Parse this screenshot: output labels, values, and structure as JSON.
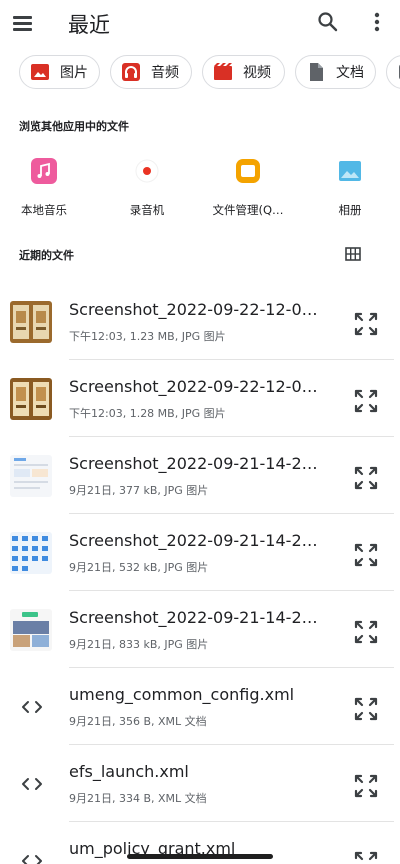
{
  "header": {
    "title": "最近"
  },
  "chips": [
    {
      "label": "图片",
      "icon": "image-icon",
      "color": "#d93025"
    },
    {
      "label": "音频",
      "icon": "headphones-icon",
      "color": "#d93025"
    },
    {
      "label": "视频",
      "icon": "video-icon",
      "color": "#d93025"
    },
    {
      "label": "文档",
      "icon": "document-icon",
      "color": "#5f6368"
    }
  ],
  "other_apps": {
    "title": "浏览其他应用中的文件",
    "items": [
      {
        "label": "本地音乐",
        "icon": "music-icon",
        "color": "#ee5b9d"
      },
      {
        "label": "录音机",
        "icon": "record-icon",
        "color": "#ea3323"
      },
      {
        "label": "文件管理(Q…",
        "icon": "folder-icon",
        "color": "#f4a300"
      },
      {
        "label": "相册",
        "icon": "gallery-icon",
        "color": "#52b8e6"
      }
    ]
  },
  "recent": {
    "title": "近期的文件",
    "files": [
      {
        "name": "Screenshot_2022-09-22-12-0…",
        "meta": "下午12:03, 1.23 MB, JPG 图片",
        "kind": "image"
      },
      {
        "name": "Screenshot_2022-09-22-12-0…",
        "meta": "下午12:03, 1.28 MB, JPG 图片",
        "kind": "image"
      },
      {
        "name": "Screenshot_2022-09-21-14-2…",
        "meta": "9月21日, 377 kB, JPG 图片",
        "kind": "image"
      },
      {
        "name": "Screenshot_2022-09-21-14-2…",
        "meta": "9月21日, 532 kB, JPG 图片",
        "kind": "image"
      },
      {
        "name": "Screenshot_2022-09-21-14-2…",
        "meta": "9月21日, 833 kB, JPG 图片",
        "kind": "image"
      },
      {
        "name": "umeng_common_config.xml",
        "meta": "9月21日, 356 B, XML 文档",
        "kind": "code"
      },
      {
        "name": "efs_launch.xml",
        "meta": "9月21日, 334 B, XML 文档",
        "kind": "code"
      },
      {
        "name": "um_policy_grant.xml",
        "meta": "",
        "kind": "code"
      }
    ]
  }
}
